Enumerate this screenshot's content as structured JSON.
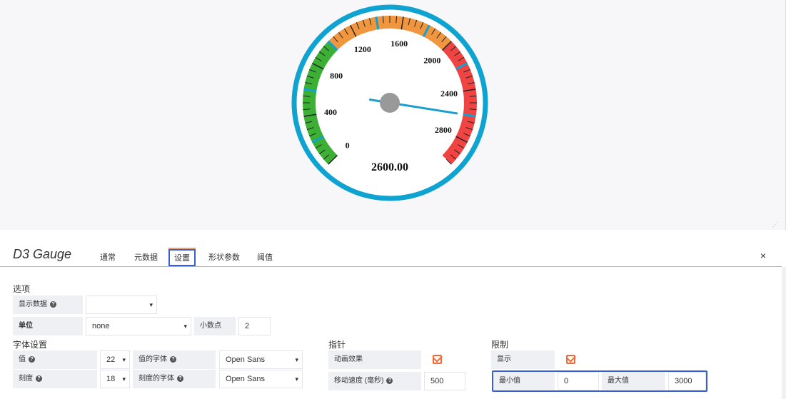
{
  "gauge": {
    "min": 0,
    "max": 3000,
    "value": 2600,
    "value_text": "2600.00",
    "tick_labels": [
      "0",
      "400",
      "800",
      "1200",
      "1600",
      "2000",
      "2400",
      "2800"
    ],
    "thresholds": [
      {
        "from": 0,
        "to": 1000,
        "color": "#3cb034"
      },
      {
        "from": 1000,
        "to": 2000,
        "color": "#f0963e"
      },
      {
        "from": 2000,
        "to": 3000,
        "color": "#f04443"
      }
    ],
    "colors": {
      "outer_ring": "#0ea3d1",
      "needle": "#1a9fce",
      "needle_hub": "#999999",
      "ticks": "#222222"
    }
  },
  "panel": {
    "title": "D3 Gauge",
    "close_icon": "×"
  },
  "tabs": [
    {
      "label": "通常"
    },
    {
      "label": "元数据"
    },
    {
      "label": "设置",
      "active": true
    },
    {
      "label": "形状参数"
    },
    {
      "label": "阈值"
    }
  ],
  "options": {
    "section_title": "选项",
    "show_data_label": "显示数据",
    "show_data_value": "",
    "unit_label": "单位",
    "unit_value": "none",
    "decimals_label": "小数点",
    "decimals_value": "2"
  },
  "fonts": {
    "section_title": "字体设置",
    "value_label": "值",
    "value_size": "22",
    "value_font_label": "值的字体",
    "value_font": "Open Sans",
    "scale_label": "刻度",
    "scale_size": "18",
    "scale_font_label": "刻度的字体",
    "scale_font": "Open Sans"
  },
  "needle": {
    "section_title": "指针",
    "animate_label": "动画效果",
    "speed_label": "移动速度 (毫秒)",
    "speed_value": "500"
  },
  "limits": {
    "section_title": "限制",
    "show_label": "显示",
    "min_label": "最小值",
    "min_value": "0",
    "max_label": "最大值",
    "max_value": "3000"
  }
}
